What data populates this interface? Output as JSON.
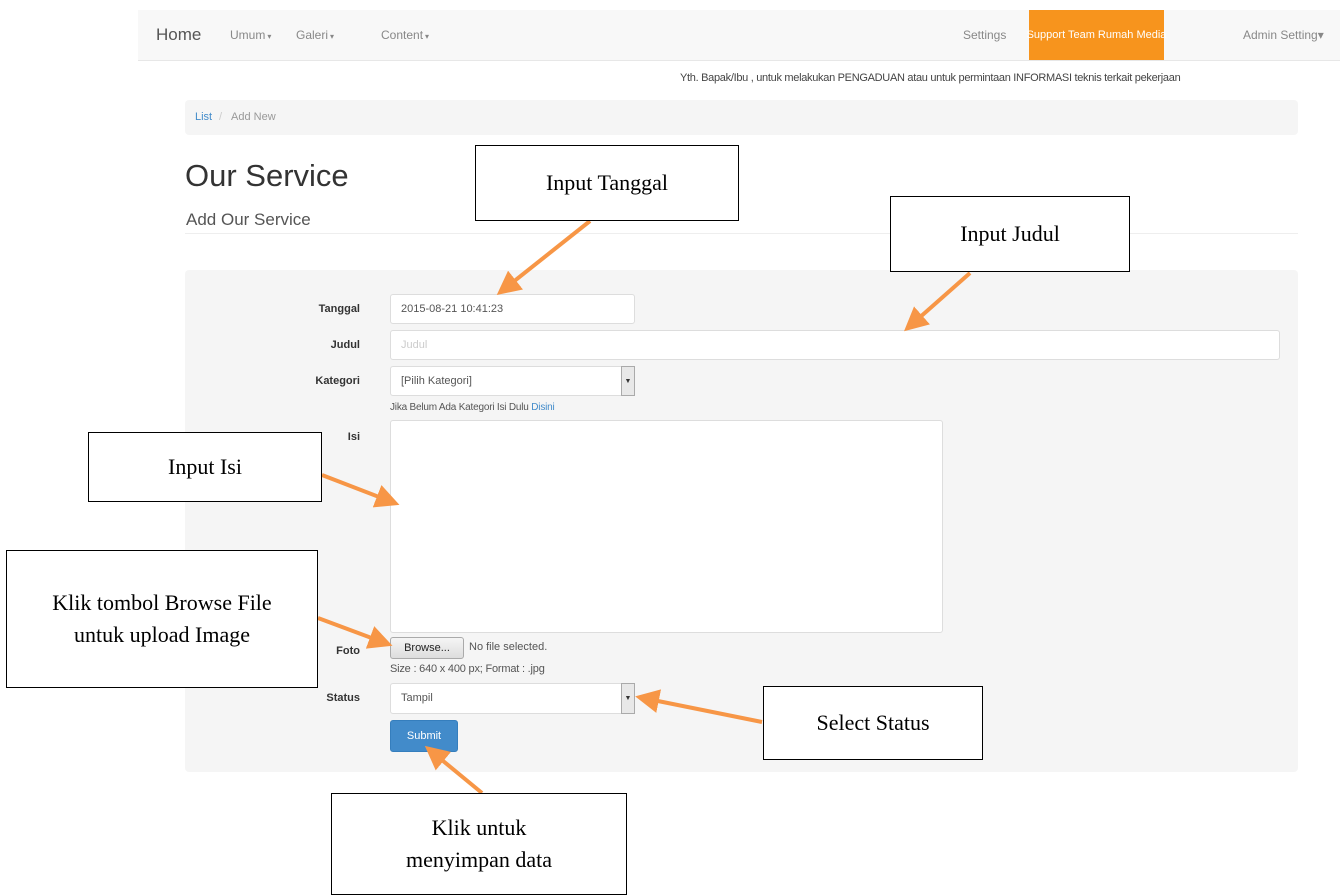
{
  "navbar": {
    "brand": "Home",
    "menus": [
      {
        "label": "Umum"
      },
      {
        "label": "Galeri"
      },
      {
        "label": "Content"
      }
    ],
    "settings": "Settings",
    "support": "Support Team Rumah Media",
    "admin": "Admin Setting",
    "accent_color": "#f7941d"
  },
  "notice": "Yth. Bapak/Ibu , untuk melakukan PENGADUAN atau untuk permintaan INFORMASI teknis terkait pekerjaan",
  "breadcrumb": {
    "list": "List",
    "separator": "/",
    "current": "Add New"
  },
  "page": {
    "title": "Our Service",
    "subtitle": "Add Our Service"
  },
  "form": {
    "tanggal": {
      "label": "Tanggal",
      "value": "2015-08-21 10:41:23"
    },
    "judul": {
      "label": "Judul",
      "placeholder": "Judul"
    },
    "kategori": {
      "label": "Kategori",
      "selected": "[Pilih Kategori]",
      "help": "Jika Belum Ada Kategori Isi Dulu",
      "help_link": "Disini"
    },
    "isi": {
      "label": "Isi"
    },
    "foto": {
      "label": "Foto",
      "browse": "Browse...",
      "no_file": "No file selected.",
      "hint": "Size : 640 x 400 px; Format : .jpg"
    },
    "status": {
      "label": "Status",
      "selected": "Tampil"
    },
    "submit": "Submit"
  },
  "callouts": {
    "tanggal": "Input Tanggal",
    "judul": "Input Judul",
    "isi": "Input Isi",
    "browse": "Klik tombol Browse File untuk upload Image",
    "status": "Select Status",
    "submit": "Klik untuk menyimpan data"
  },
  "colors": {
    "arrow": "#f79646",
    "primary": "#428bca"
  }
}
